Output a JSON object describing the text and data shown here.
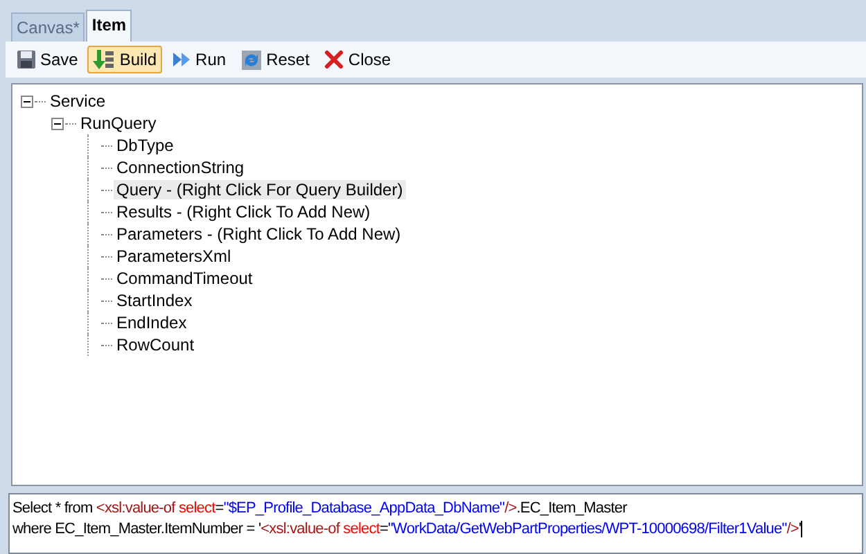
{
  "tabs": [
    {
      "label": "Canvas*",
      "selected": false
    },
    {
      "label": "Item",
      "selected": true
    }
  ],
  "toolbar": [
    {
      "label": "Save",
      "kind": "save",
      "active": false
    },
    {
      "label": "Build",
      "kind": "build",
      "active": true
    },
    {
      "label": "Run",
      "kind": "run",
      "active": false
    },
    {
      "label": "Reset",
      "kind": "reset",
      "active": false
    },
    {
      "label": "Close",
      "kind": "close",
      "active": false
    }
  ],
  "tree": [
    {
      "label": "Service",
      "expanded": true,
      "selected": false,
      "children": [
        {
          "label": "RunQuery",
          "expanded": true,
          "selected": false,
          "children": [
            {
              "label": "DbType",
              "selected": false
            },
            {
              "label": "ConnectionString",
              "selected": false
            },
            {
              "label": "Query - (Right Click For Query Builder)",
              "selected": true
            },
            {
              "label": "Results - (Right Click To Add New)",
              "selected": false
            },
            {
              "label": "Parameters - (Right Click To Add New)",
              "selected": false
            },
            {
              "label": "ParametersXml",
              "selected": false
            },
            {
              "label": "CommandTimeout",
              "selected": false
            },
            {
              "label": "StartIndex",
              "selected": false
            },
            {
              "label": "EndIndex",
              "selected": false
            },
            {
              "label": "RowCount",
              "selected": false
            }
          ]
        }
      ]
    }
  ],
  "editor": {
    "lines": [
      [
        {
          "kind": "plain",
          "text": "Select * from "
        },
        {
          "kind": "tag",
          "text": "<xsl:value-of "
        },
        {
          "kind": "attr",
          "text": "select"
        },
        {
          "kind": "plain",
          "text": "="
        },
        {
          "kind": "value",
          "text": "\"$EP_Profile_Database_AppData_DbName\""
        },
        {
          "kind": "tag",
          "text": "/>"
        },
        {
          "kind": "plain",
          "text": ".EC_Item_Master"
        }
      ],
      [
        {
          "kind": "plain",
          "text": "where EC_Item_Master.ItemNumber = '"
        },
        {
          "kind": "tag",
          "text": "<xsl:value-of "
        },
        {
          "kind": "attr",
          "text": "select"
        },
        {
          "kind": "plain",
          "text": "="
        },
        {
          "kind": "value",
          "text": "\"WorkData/GetWebPartProperties/WPT-10000698/Filter1Value\""
        },
        {
          "kind": "tag",
          "text": "/>"
        },
        {
          "kind": "plain",
          "text": "'"
        }
      ]
    ]
  }
}
